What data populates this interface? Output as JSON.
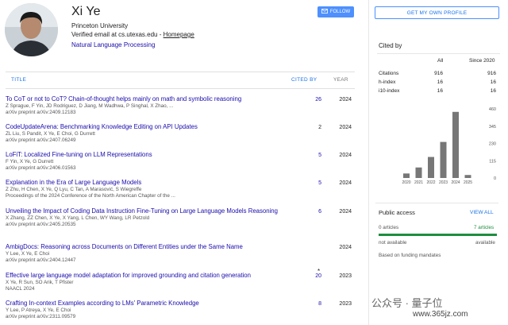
{
  "profile": {
    "name": "Xi Ye",
    "affiliation": "Princeton University",
    "email_text": "Verified email at cs.utexas.edu - ",
    "homepage_label": "Homepage",
    "interest": "Natural Language Processing",
    "follow_label": "FOLLOW",
    "get_profile_label": "GET MY OWN PROFILE"
  },
  "table": {
    "col_title": "TITLE",
    "col_cited": "CITED BY",
    "col_year": "YEAR",
    "rows": [
      {
        "title": "To CoT or not to CoT? Chain-of-thought helps mainly on math and symbolic reasoning",
        "authors": "Z Sprague, F Yin, JD Rodriguez, D Jiang, M Wadhwa, P Singhal, X Zhao, ...",
        "venue": "arXiv preprint arXiv:2409.12183",
        "cited": "26",
        "year": "2024"
      },
      {
        "title": "CodeUpdateArena: Benchmarking Knowledge Editing on API Updates",
        "authors": "ZL Liu, S Pandit, X Ye, E Choi, G Durrett",
        "venue": "arXiv preprint arXiv:2407.06249",
        "cited": "2",
        "year": "2024"
      },
      {
        "title": "LoFiT: Localized Fine-tuning on LLM Representations",
        "authors": "F Yin, X Ye, G Durrett",
        "venue": "arXiv preprint arXiv:2406.01563",
        "cited": "5",
        "year": "2024"
      },
      {
        "title": "Explanation in the Era of Large Language Models",
        "authors": "Z Zhu, H Chen, X Ye, Q Lyu, C Tan, A Marasović, S Wiegreffe",
        "venue": "Proceedings of the 2024 Conference of the North American Chapter of the ...",
        "cited": "5",
        "year": "2024"
      },
      {
        "title": "Unveiling the Impact of Coding Data Instruction Fine-Tuning on Large Language Models Reasoning",
        "authors": "X Zhang, ZZ Chen, X Ye, X Yang, L Chen, WY Wang, LR Petzold",
        "venue": "arXiv preprint arXiv:2405.20535",
        "cited": "6",
        "year": "2024"
      },
      {
        "title": "AmbigDocs: Reasoning across Documents on Different Entities under the Same Name",
        "authors": "Y Lee, X Ye, E Choi",
        "venue": "arXiv preprint arXiv:2404.12447",
        "cited": "",
        "year": "2024"
      },
      {
        "title": "Effective large language model adaptation for improved grounding and citation generation",
        "authors": "X Ye, R Sun, SO Arik, T Pfister",
        "venue": "NAACL 2024",
        "cited": "20",
        "star": "*",
        "year": "2023"
      },
      {
        "title": "Crafting In-context Examples according to LMs' Parametric Knowledge",
        "authors": "Y Lee, P Atreya, X Ye, E Choi",
        "venue": "arXiv preprint arXiv:2311.09579",
        "cited": "8",
        "year": "2023"
      }
    ]
  },
  "cited_by": {
    "title": "Cited by",
    "col_all": "All",
    "col_since": "Since 2020",
    "metrics": [
      {
        "label": "Citations",
        "all": "916",
        "since": "916"
      },
      {
        "label": "h-index",
        "all": "16",
        "since": "16"
      },
      {
        "label": "i10-index",
        "all": "16",
        "since": "16"
      }
    ]
  },
  "chart_data": {
    "type": "bar",
    "categories": [
      "2020",
      "2021",
      "2022",
      "2023",
      "2024",
      "2025"
    ],
    "values": [
      30,
      70,
      140,
      240,
      440,
      20
    ],
    "ylim": [
      0,
      460
    ],
    "yticks": [
      "460",
      "345",
      "230",
      "115",
      "0"
    ],
    "bar_color": "#777777"
  },
  "public_access": {
    "title": "Public access",
    "view_all": "VIEW ALL",
    "left_count": "0 articles",
    "right_count": "7 articles",
    "left_status": "not available",
    "right_status": "available",
    "note": "Based on funding mandates",
    "available_color": "#1e8e3e"
  },
  "watermark": {
    "line1": "公众号 · 量子位",
    "line2": "www.365jz.com"
  }
}
